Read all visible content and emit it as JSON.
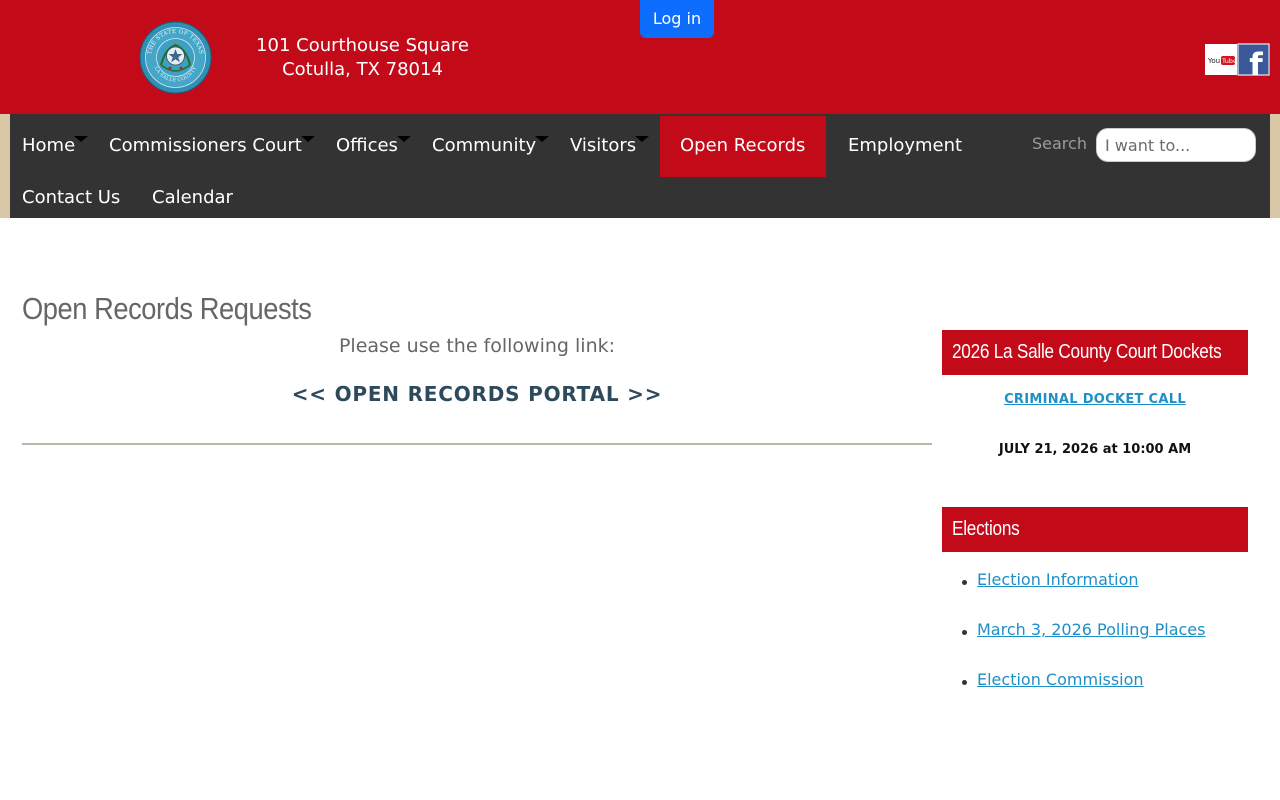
{
  "header": {
    "address_line1": "101 Courthouse Square",
    "address_line2": "Cotulla, TX 78014",
    "login_label": "Log in",
    "seal_text_top": "THE STATE OF TEXAS",
    "seal_text_bottom": "LA SALLE COUNTY",
    "youtube_label": "YouTube",
    "facebook_label": "f"
  },
  "nav": {
    "items": [
      {
        "label": "Home",
        "dropdown": true
      },
      {
        "label": "Commissioners Court",
        "dropdown": true
      },
      {
        "label": "Offices",
        "dropdown": true
      },
      {
        "label": "Community",
        "dropdown": true
      },
      {
        "label": "Visitors",
        "dropdown": true
      },
      {
        "label": "Open Records",
        "dropdown": false,
        "active": true
      },
      {
        "label": "Employment",
        "dropdown": false
      },
      {
        "label": "Contact Us",
        "dropdown": false
      },
      {
        "label": "Calendar",
        "dropdown": false
      }
    ],
    "search_label": "Search",
    "search_placeholder": "I want to..."
  },
  "main": {
    "title": "Open Records Requests",
    "intro": "Please use the following link:",
    "portal_link": "<< OPEN RECORDS PORTAL >>"
  },
  "sidebar": {
    "dockets": {
      "heading": "2026 La Salle County Court Dockets",
      "link": "CRIMINAL DOCKET CALL",
      "date": "JULY 21, 2026 at 10:00 AM"
    },
    "elections": {
      "heading": "Elections",
      "items": [
        "Election Information",
        "March 3, 2026 Polling Places",
        "Election Commission"
      ]
    }
  },
  "colors": {
    "brand_red": "#c20a19",
    "nav_dark": "#333333",
    "login_blue": "#0d6efd",
    "link_blue": "#1e8fc7",
    "portal_navy": "#2d4a5c"
  }
}
